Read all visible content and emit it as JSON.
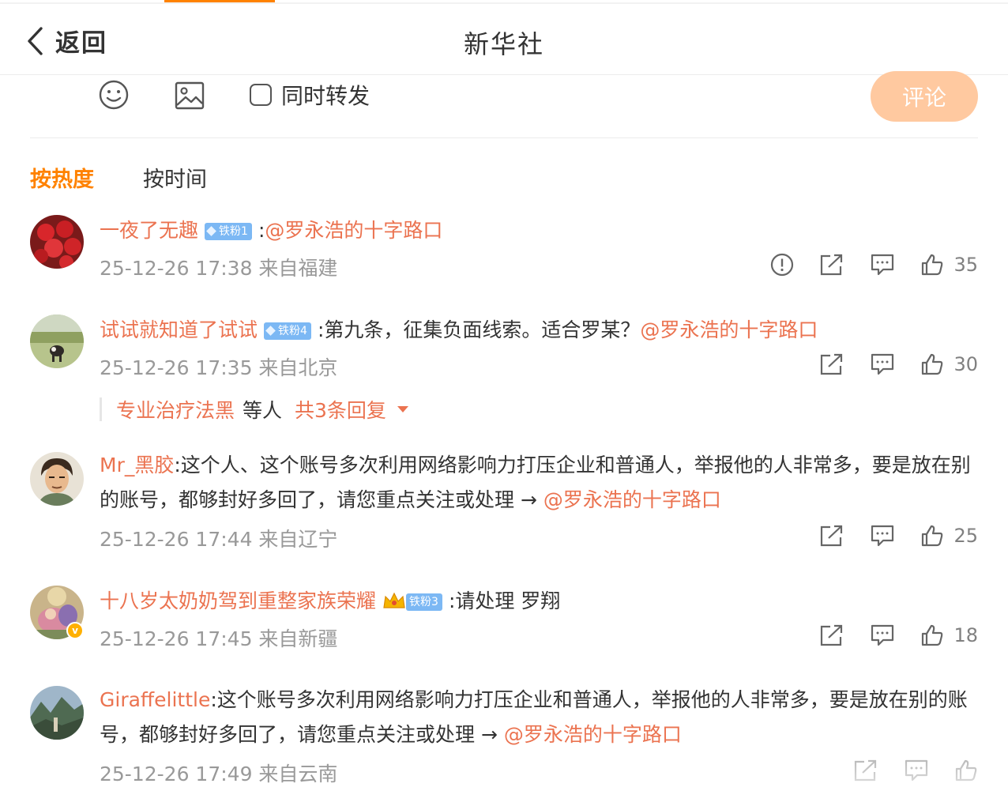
{
  "nav": {
    "back_label": "返回",
    "title": "新华社"
  },
  "composer": {
    "repost_label": "同时转发",
    "submit_label": "评论"
  },
  "sort": {
    "hot": "按热度",
    "time": "按时间"
  },
  "comments": [
    {
      "user": "一夜了无趣",
      "badge": "铁粉1",
      "text": ":",
      "mention": "@罗永浩的十字路口",
      "meta": "25-12-26 17:38 来自福建",
      "likes": "35"
    },
    {
      "user": "试试就知道了试试",
      "badge": "铁粉4",
      "text": ":第九条，征集负面线索。适合罗某？",
      "mention": "@罗永浩的十字路口",
      "meta": "25-12-26 17:35 来自北京",
      "likes": "30",
      "replies": {
        "name": "专业治疗法黑",
        "etc": "等人",
        "more": "共3条回复"
      }
    },
    {
      "user": "Mr_黑胶",
      "text": ":这个人、这个账号多次利用网络影响力打压企业和普通人，举报他的人非常多，要是放在别的账号，都够封好多回了，请您重点关注或处理 → ",
      "mention": "@罗永浩的十字路口",
      "meta": "25-12-26 17:44 来自辽宁",
      "likes": "25"
    },
    {
      "user": "十八岁太奶奶驾到重整家族荣耀",
      "badge": "铁粉3",
      "text": ":请处理 罗翔",
      "meta": "25-12-26 17:45 来自新疆",
      "likes": "18"
    },
    {
      "user": "Giraffelittle",
      "text": ":这个账号多次利用网络影响力打压企业和普通人，举报他的人非常多，要是放在别的账号，都够封好多回了，请您重点关注或处理 → ",
      "mention": "@罗永浩的十字路口",
      "meta": "25-12-26 17:49 来自云南"
    }
  ],
  "colors": {
    "accent": "#ff8200",
    "link": "#eb7350",
    "submit_disabled": "#ffc9a0"
  }
}
